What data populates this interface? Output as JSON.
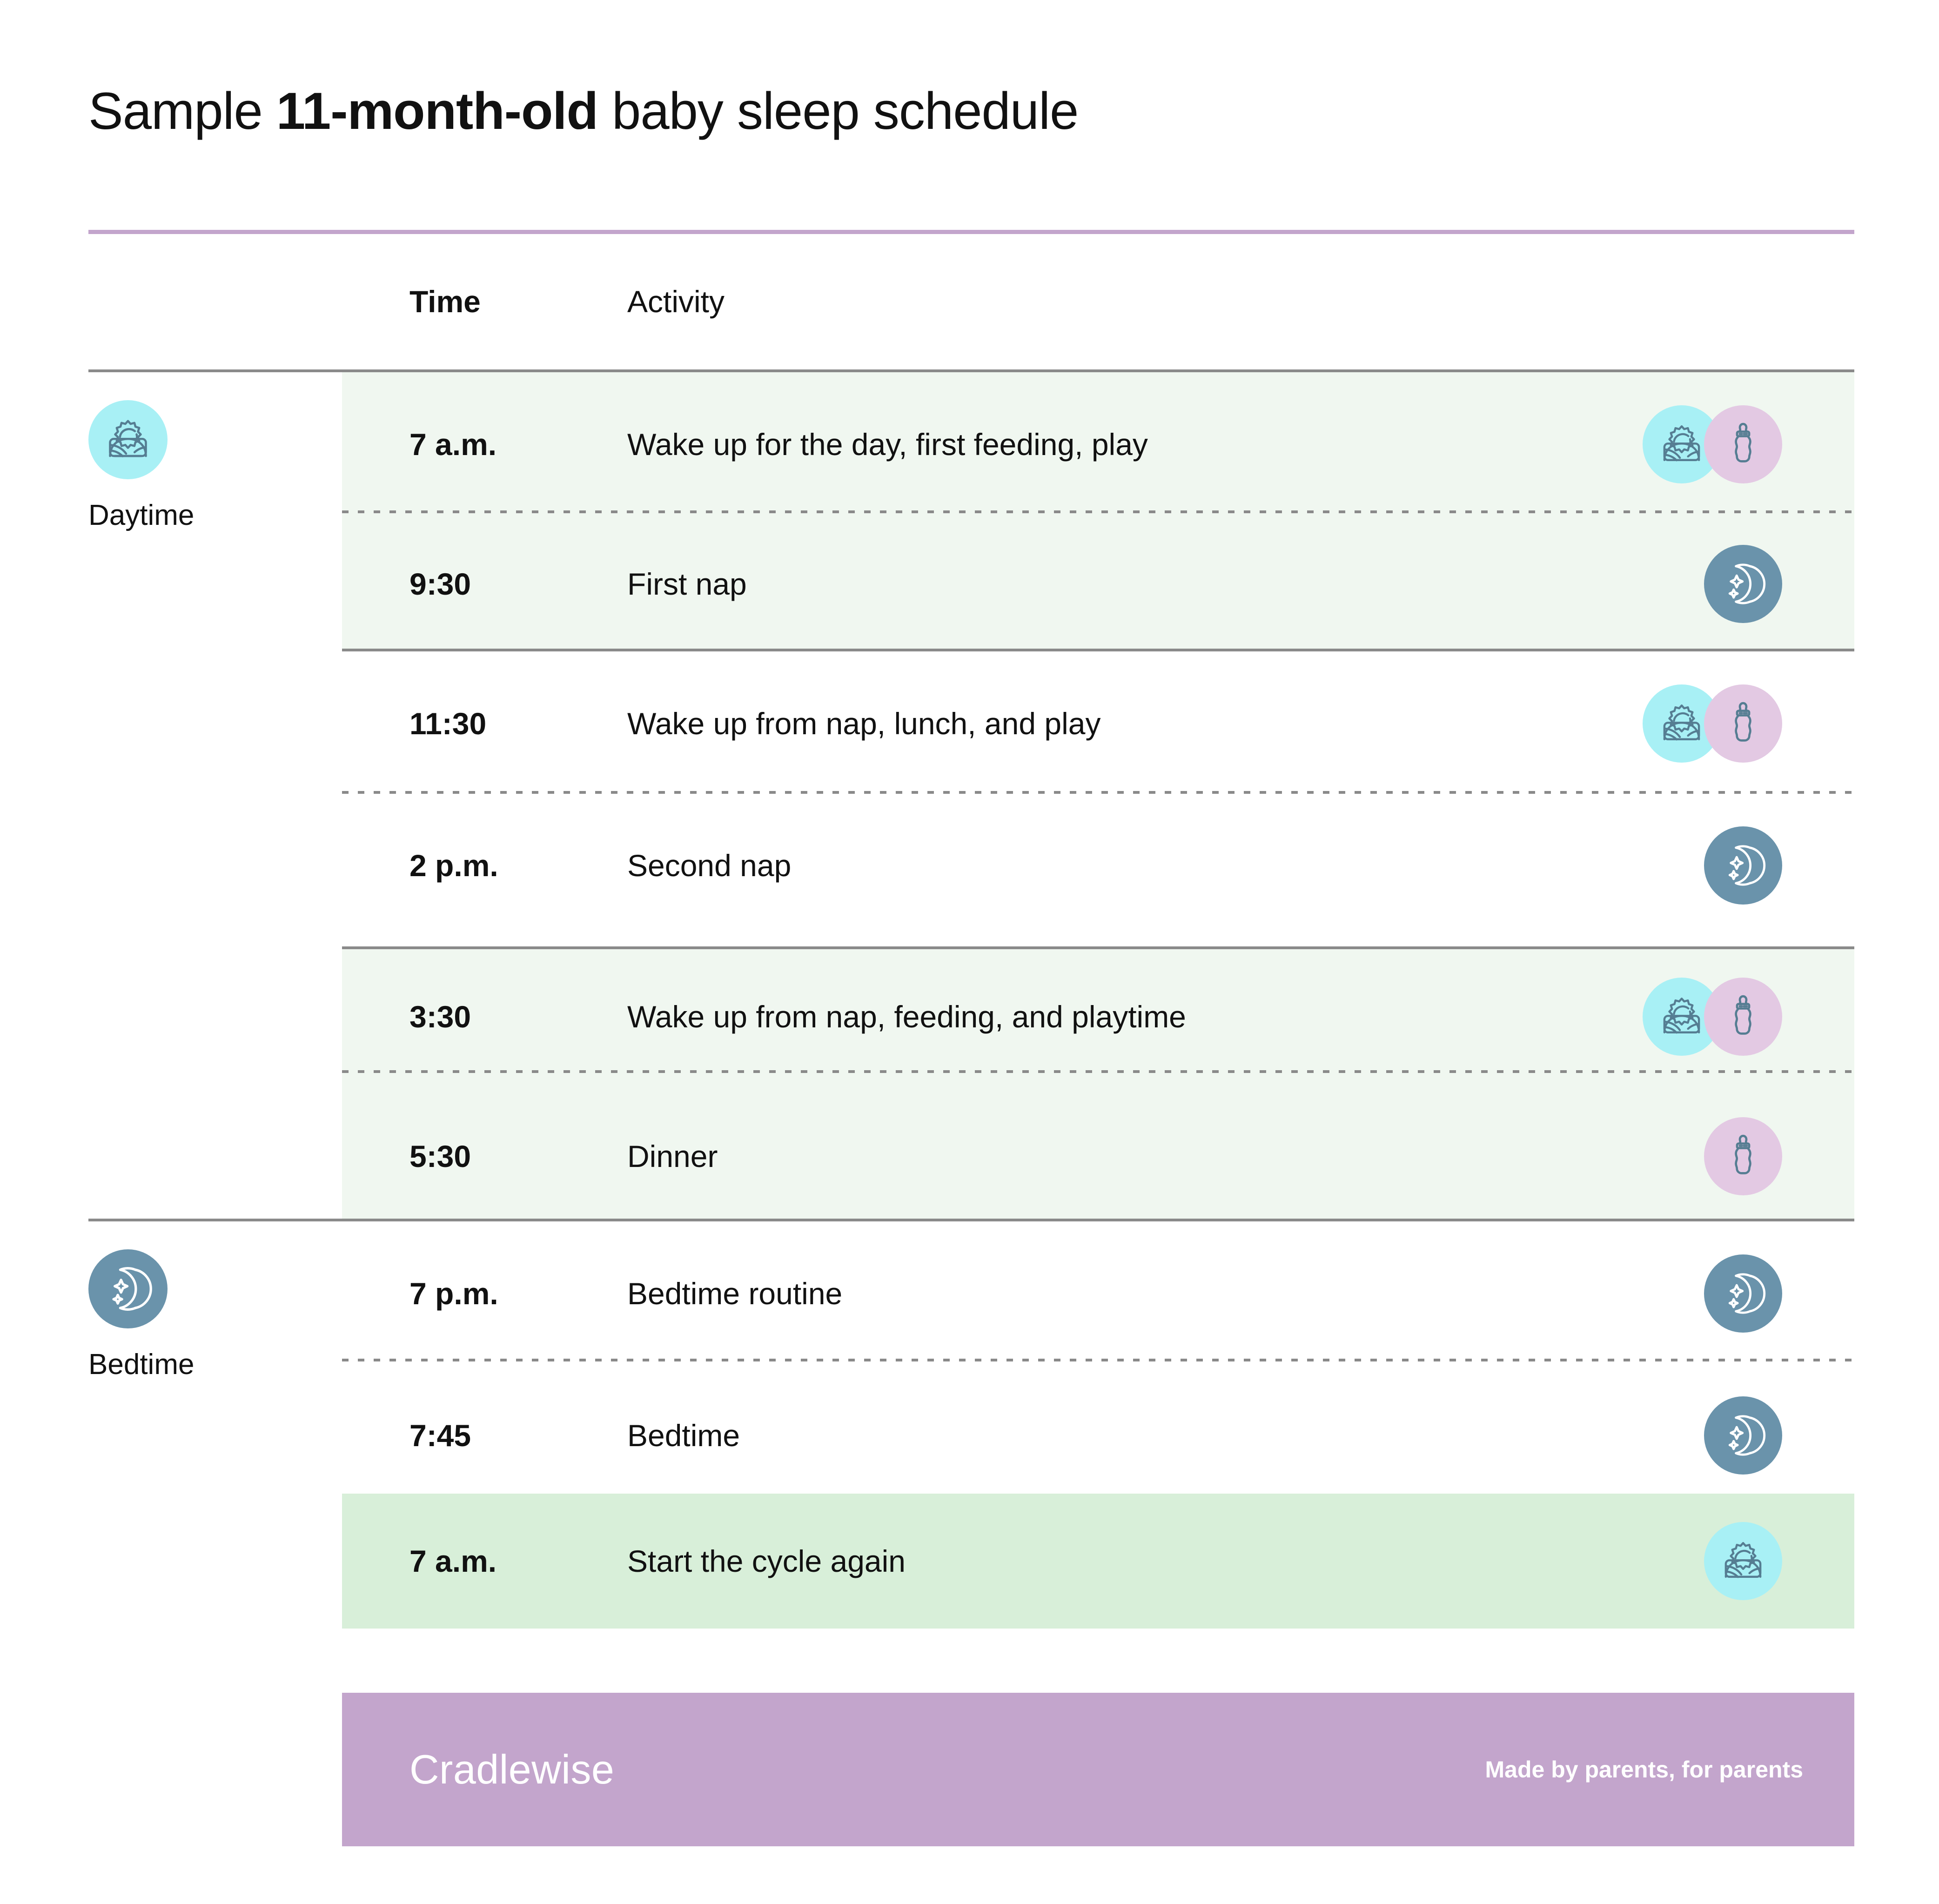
{
  "title": {
    "prefix": "Sample ",
    "highlight": "11-month-old",
    "suffix": " baby sleep schedule"
  },
  "columns": {
    "time": "Time",
    "activity": "Activity"
  },
  "sections": [
    {
      "key": "daytime",
      "label": "Daytime",
      "icon": "sunrise-icon"
    },
    {
      "key": "bedtime",
      "label": "Bedtime",
      "icon": "moon-icon"
    }
  ],
  "rows": [
    {
      "time": "7 a.m.",
      "activity": "Wake up for the day, first feeding, play",
      "icons": [
        "sunrise-icon",
        "baby-bottle-icon"
      ],
      "highlight": "light"
    },
    {
      "time": "9:30",
      "activity": "First nap",
      "icons": [
        "moon-icon"
      ],
      "highlight": "light"
    },
    {
      "time": "11:30",
      "activity": "Wake up from nap, lunch, and play",
      "icons": [
        "sunrise-icon",
        "baby-bottle-icon"
      ],
      "highlight": "none"
    },
    {
      "time": "2 p.m.",
      "activity": "Second nap",
      "icons": [
        "moon-icon"
      ],
      "highlight": "none"
    },
    {
      "time": "3:30",
      "activity": "Wake up from nap, feeding, and playtime",
      "icons": [
        "sunrise-icon",
        "baby-bottle-icon"
      ],
      "highlight": "light"
    },
    {
      "time": "5:30",
      "activity": "Dinner",
      "icons": [
        "baby-bottle-icon"
      ],
      "highlight": "light"
    },
    {
      "time": "7 p.m.",
      "activity": "Bedtime routine",
      "icons": [
        "moon-icon"
      ],
      "highlight": "none"
    },
    {
      "time": "7:45",
      "activity": "Bedtime",
      "icons": [
        "moon-icon"
      ],
      "highlight": "none"
    },
    {
      "time": "7 a.m.",
      "activity": "Start the cycle again",
      "icons": [
        "sunrise-icon"
      ],
      "highlight": "strong"
    }
  ],
  "footer": {
    "brand": "Cradlewise",
    "tagline": "Made by parents, for parents"
  },
  "colors": {
    "accent_purple": "#c3a5cc",
    "band_light_green": "#f0f7f0",
    "band_strong_green": "#d8efd9",
    "sun_chip": "#a8f0f5",
    "bottle_chip": "#e3c9e3",
    "moon_chip": "#6a93ab",
    "icon_stroke": "#557d92",
    "rule_gray": "#8a8a8a",
    "text": "#111111"
  }
}
